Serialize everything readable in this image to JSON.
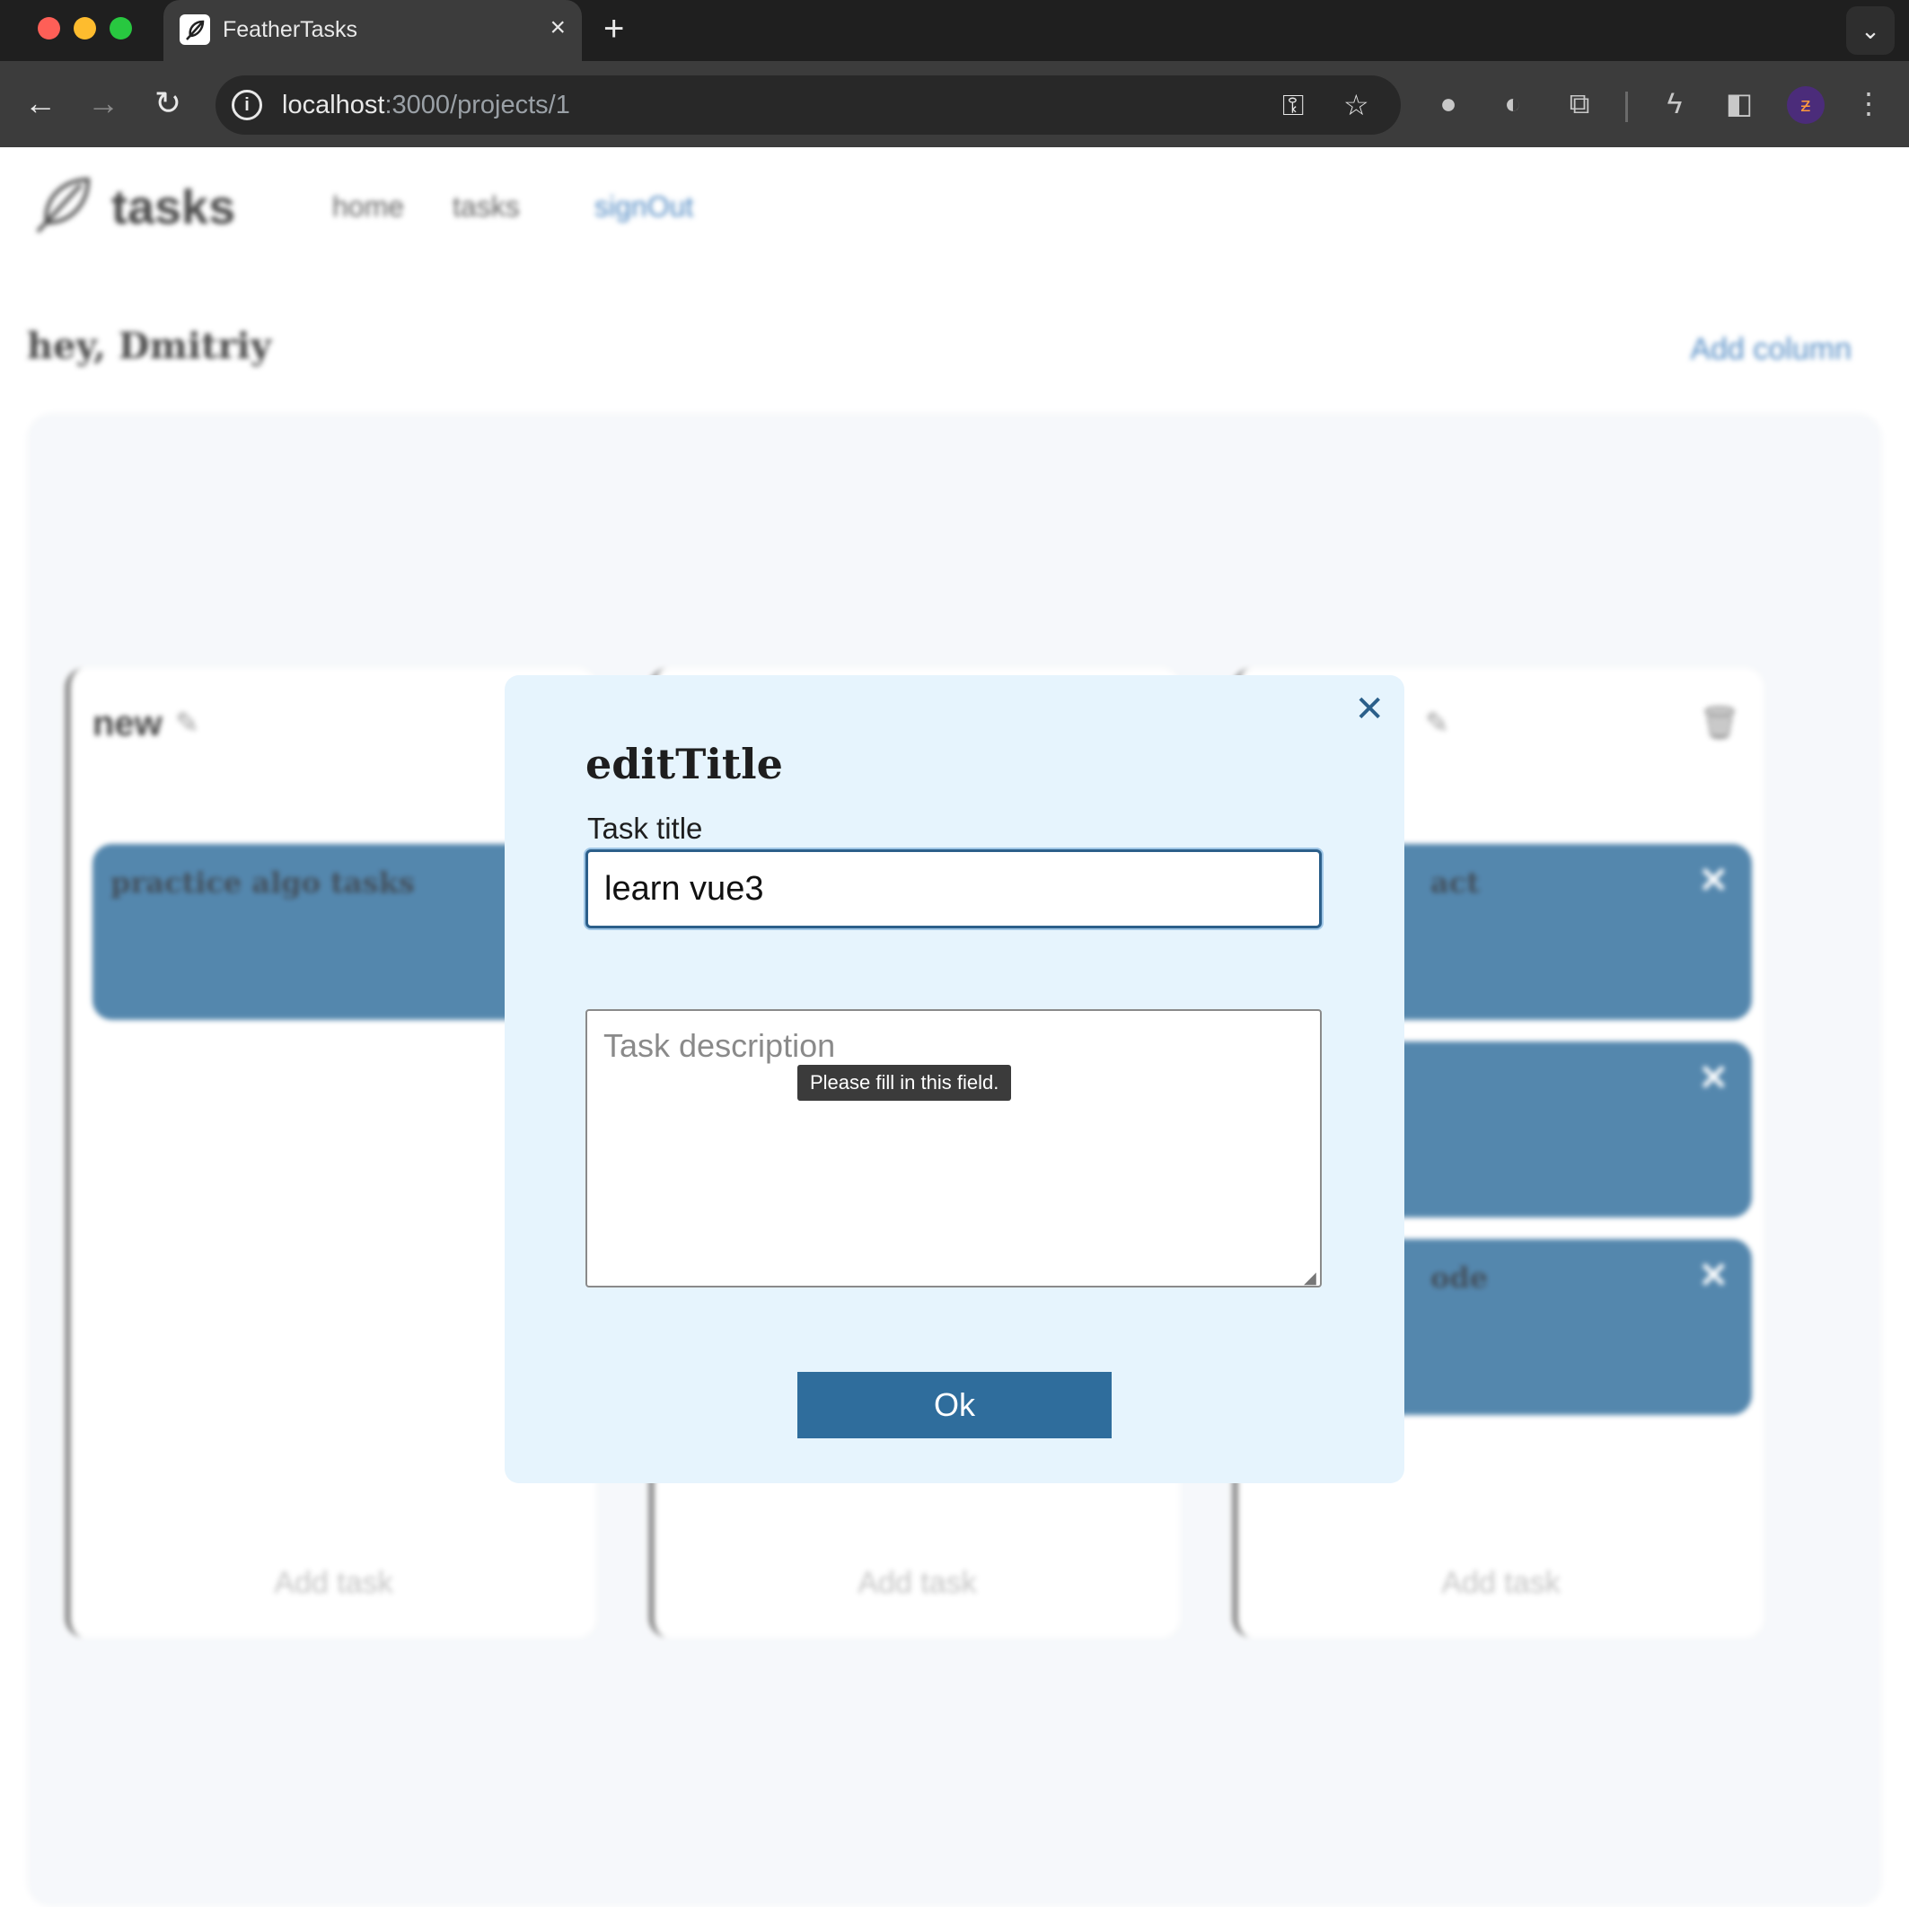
{
  "browser": {
    "tab_title": "FeatherTasks",
    "tab_favicon_icon": "feather-icon",
    "url_host": "localhost",
    "url_path": ":3000/projects/1",
    "new_tab": "+",
    "tab_close": "×"
  },
  "header": {
    "logo_text": "tasks",
    "logo_icon": "feather-icon",
    "nav": {
      "home": "home",
      "tasks": "tasks",
      "sign_out": "signOut"
    }
  },
  "page": {
    "greeting": "hey, Dmitriy",
    "add_column": "Add column"
  },
  "board": {
    "columns": [
      {
        "title": "new",
        "tasks": [
          "practice algo tasks"
        ],
        "add_task": "Add task"
      },
      {
        "title": "",
        "tasks": [],
        "add_task": "Add task"
      },
      {
        "title": "",
        "tasks": [
          "act",
          "",
          "ode"
        ],
        "add_task": "Add task"
      }
    ]
  },
  "modal": {
    "title": "editTitle",
    "title_label": "Task title",
    "title_value": "learn vue3",
    "description_placeholder": "Task description",
    "validation_tooltip": "Please fill in this field.",
    "ok_label": "Ok",
    "close_icon": "close-icon"
  },
  "colors": {
    "accent": "#2f6d9c",
    "modal_bg": "#e6f4fd",
    "link": "#2e73b8"
  }
}
